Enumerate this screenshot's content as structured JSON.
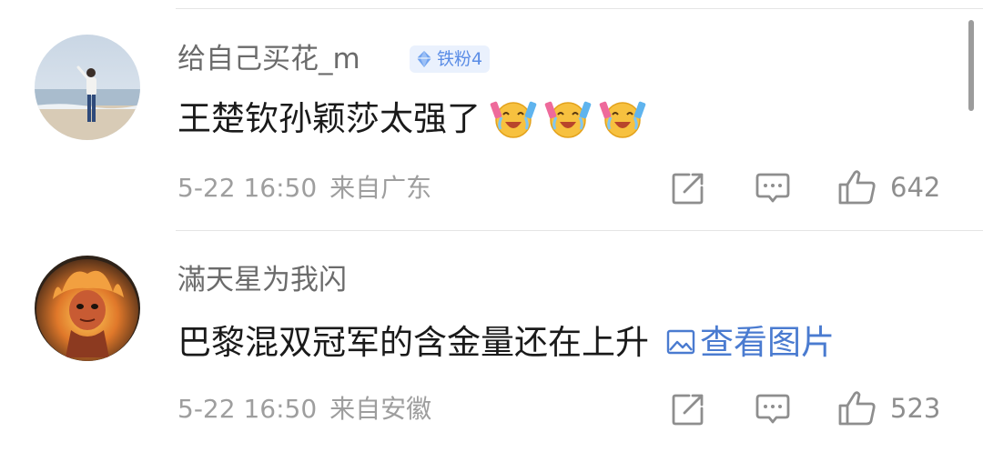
{
  "comments": [
    {
      "username": "给自己买花_m",
      "badge": "铁粉4",
      "text": "王楚钦孙颖莎太强了",
      "emojis": [
        "crying-laughing-cheer-emoji",
        "crying-laughing-cheer-emoji",
        "crying-laughing-cheer-emoji"
      ],
      "date": "5-22 16:50",
      "location": "来自广东",
      "likes": "642"
    },
    {
      "username": "滿天星为我闪",
      "text": "巴黎混双冠军的含金量还在上升",
      "link_label": "查看图片",
      "date": "5-22 16:50",
      "location": "来自安徽",
      "likes": "523"
    }
  ],
  "icons": {
    "share": "share-icon",
    "comment": "comment-icon",
    "like": "thumbs-up-icon",
    "image": "image-icon",
    "badge": "diamond-icon"
  },
  "colors": {
    "link": "#4a7bd0",
    "badge_bg": "#eaf1fd",
    "badge_text": "#5b8de6",
    "meta": "#9e9e9e"
  }
}
